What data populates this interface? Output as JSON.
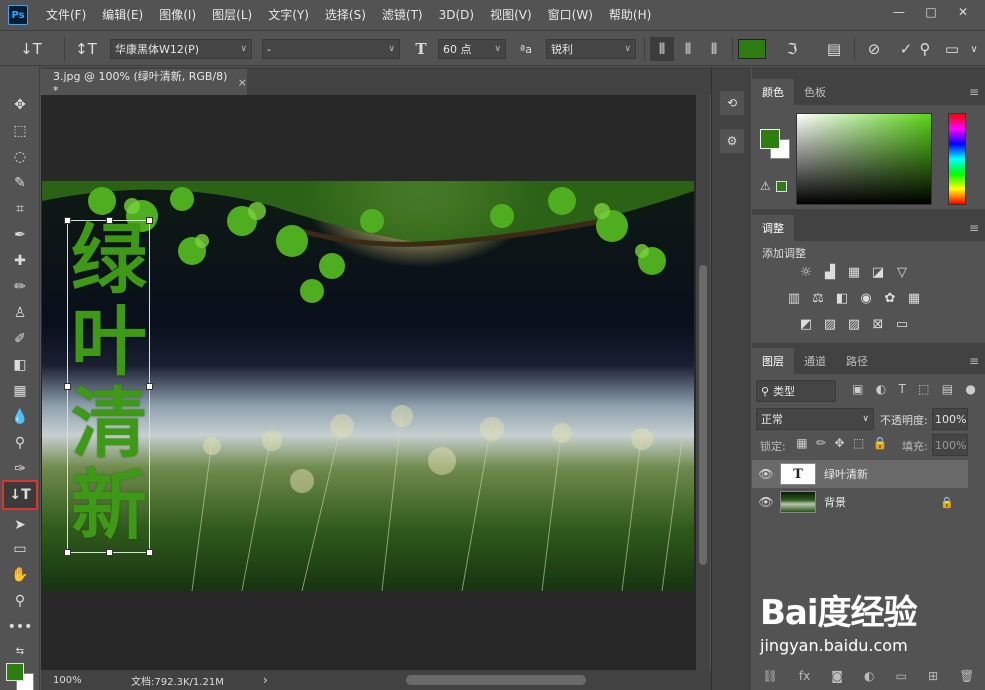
{
  "menubar": {
    "logo": "Ps",
    "items": [
      "文件(F)",
      "编辑(E)",
      "图像(I)",
      "图层(L)",
      "文字(Y)",
      "选择(S)",
      "滤镜(T)",
      "3D(D)",
      "视图(V)",
      "窗口(W)",
      "帮助(H)"
    ],
    "min": "—",
    "max": "□",
    "close": "✕"
  },
  "options": {
    "font_family": "华康黑体W12(P)",
    "font_style": "-",
    "font_size": "60 点",
    "antialias": "锐利",
    "text_color": "#2e7d11"
  },
  "document": {
    "tab_title": "3.jpg @ 100% (绿叶清新, RGB/8) *",
    "tab_close": "×",
    "vertical_text": [
      "绿",
      "叶",
      "清",
      "新"
    ],
    "text_color": "#3e9a16"
  },
  "status": {
    "zoom": "100%",
    "doc_info": "文档:792.3K/1.21M",
    "arrow": "›"
  },
  "panels": {
    "color_tabs": [
      "颜色",
      "色板"
    ],
    "adjust_tab": "调整",
    "adjust_label": "添加调整",
    "layers_tabs": [
      "图层",
      "通道",
      "路径"
    ],
    "filter_kind": "类型",
    "blend_mode": "正常",
    "opacity_label": "不透明度:",
    "opacity_value": "100%",
    "lock_label": "锁定:",
    "fill_label": "填充:",
    "fill_value": "100%",
    "layers": [
      {
        "name": "绿叶清新",
        "type": "text",
        "thumb": "T",
        "selected": true
      },
      {
        "name": "背景",
        "type": "image",
        "selected": false,
        "locked": true
      }
    ],
    "menu_icon": "≡"
  },
  "watermark": {
    "brand": "Bai度经验",
    "url": "jingyan.baidu.com"
  },
  "colors": {
    "foreground": "#2e7d11",
    "background": "#ffffff",
    "selection_highlight": "#e0332f"
  }
}
